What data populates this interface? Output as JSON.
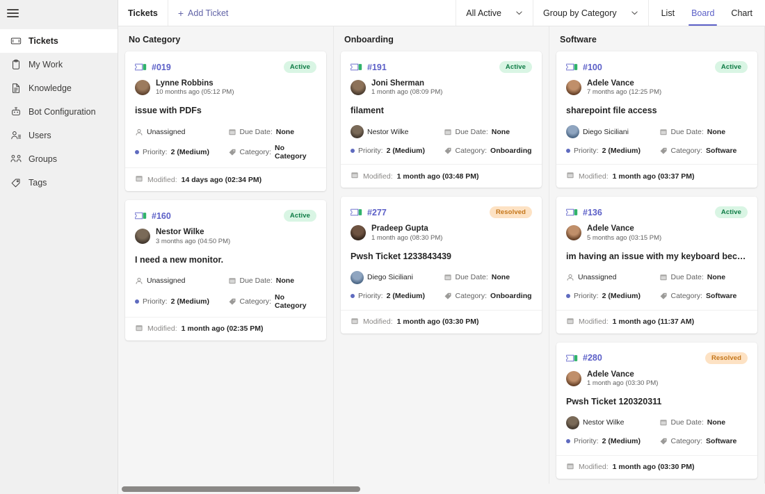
{
  "sidebar": {
    "menu_icon": "hamburger-icon",
    "items": [
      {
        "label": "Tickets",
        "icon": "ticket-icon",
        "active": true
      },
      {
        "label": "My Work",
        "icon": "clipboard-icon",
        "active": false
      },
      {
        "label": "Knowledge",
        "icon": "document-icon",
        "active": false
      },
      {
        "label": "Bot Configuration",
        "icon": "bot-icon",
        "active": false
      },
      {
        "label": "Users",
        "icon": "users-icon",
        "active": false
      },
      {
        "label": "Groups",
        "icon": "groups-icon",
        "active": false
      },
      {
        "label": "Tags",
        "icon": "tag-icon",
        "active": false
      }
    ]
  },
  "toolbar": {
    "title": "Tickets",
    "add_label": "Add Ticket",
    "add_icon": "plus-icon",
    "filter_label": "All Active",
    "group_label": "Group by Category",
    "chevron_icon": "chevron-down-icon",
    "views": [
      {
        "label": "List",
        "selected": false
      },
      {
        "label": "Board",
        "selected": true
      },
      {
        "label": "Chart",
        "selected": false
      }
    ]
  },
  "labels": {
    "due_date": "Due Date:",
    "category": "Category:",
    "priority": "Priority:",
    "modified": "Modified:",
    "unassigned": "Unassigned"
  },
  "colors": {
    "accent": "#5b5fc7",
    "active_badge_bg": "#d9f5e4",
    "active_badge_fg": "#0e7b45",
    "resolved_badge_bg": "#fde2c4",
    "resolved_badge_fg": "#c4761a",
    "sidebar_bg": "#f0f0f0",
    "board_bg": "#f5f5f5"
  },
  "board": {
    "columns": [
      {
        "title": "No Category",
        "cards": [
          {
            "id": "#019",
            "status": "Active",
            "status_kind": "active",
            "requester": "Lynne Robbins",
            "requester_time": "10 months ago (05:12 PM)",
            "avatar_colors": [
              "#9c7b5e",
              "#5a3f2b"
            ],
            "title": "issue with PDFs",
            "assignee": "Unassigned",
            "assignee_avatar": null,
            "assignee_colors": null,
            "priority": "2 (Medium)",
            "due_date": "None",
            "category": "No Category",
            "modified": "14 days ago (02:34 PM)"
          },
          {
            "id": "#160",
            "status": "Active",
            "status_kind": "active",
            "requester": "Nestor Wilke",
            "requester_time": "3 months ago (04:50 PM)",
            "avatar_colors": [
              "#7a6a58",
              "#3d332a"
            ],
            "title": "I need a new monitor.",
            "assignee": "Unassigned",
            "assignee_avatar": null,
            "assignee_colors": null,
            "priority": "2 (Medium)",
            "due_date": "None",
            "category": "No Category",
            "modified": "1 month ago (02:35 PM)"
          }
        ]
      },
      {
        "title": "Onboarding",
        "cards": [
          {
            "id": "#191",
            "status": "Active",
            "status_kind": "active",
            "requester": "Joni Sherman",
            "requester_time": "1 month ago (08:09 PM)",
            "avatar_colors": [
              "#8d7259",
              "#42352a"
            ],
            "title": "filament",
            "assignee": "Nestor Wilke",
            "assignee_avatar": "nestor",
            "assignee_colors": [
              "#7a6a58",
              "#3d332a"
            ],
            "priority": "2 (Medium)",
            "due_date": "None",
            "category": "Onboarding",
            "modified": "1 month ago (03:48 PM)"
          },
          {
            "id": "#277",
            "status": "Resolved",
            "status_kind": "resolved",
            "requester": "Pradeep Gupta",
            "requester_time": "1 month ago (08:30 PM)",
            "avatar_colors": [
              "#6e5341",
              "#2e2118"
            ],
            "title": "Pwsh Ticket 1233843439",
            "assignee": "Diego Siciliani",
            "assignee_avatar": "diego",
            "assignee_colors": [
              "#8fa5c0",
              "#44607f"
            ],
            "priority": "2 (Medium)",
            "due_date": "None",
            "category": "Onboarding",
            "modified": "1 month ago (03:30 PM)"
          }
        ]
      },
      {
        "title": "Software",
        "cards": [
          {
            "id": "#100",
            "status": "Active",
            "status_kind": "active",
            "requester": "Adele Vance",
            "requester_time": "7 months ago (12:25 PM)",
            "avatar_colors": [
              "#c08f6a",
              "#5e3a22"
            ],
            "title": "sharepoint file access",
            "assignee": "Diego Siciliani",
            "assignee_avatar": "diego",
            "assignee_colors": [
              "#8fa5c0",
              "#44607f"
            ],
            "priority": "2 (Medium)",
            "due_date": "None",
            "category": "Software",
            "modified": "1 month ago (03:37 PM)"
          },
          {
            "id": "#136",
            "status": "Active",
            "status_kind": "active",
            "requester": "Adele Vance",
            "requester_time": "5 months ago (03:15 PM)",
            "avatar_colors": [
              "#c08f6a",
              "#5e3a22"
            ],
            "title": "im having an issue with my keyboard because i…",
            "assignee": "Unassigned",
            "assignee_avatar": null,
            "assignee_colors": null,
            "priority": "2 (Medium)",
            "due_date": "None",
            "category": "Software",
            "modified": "1 month ago (11:37 AM)"
          },
          {
            "id": "#280",
            "status": "Resolved",
            "status_kind": "resolved",
            "requester": "Adele Vance",
            "requester_time": "1 month ago (03:30 PM)",
            "avatar_colors": [
              "#c08f6a",
              "#5e3a22"
            ],
            "title": "Pwsh Ticket 120320311",
            "assignee": "Nestor Wilke",
            "assignee_avatar": "nestor",
            "assignee_colors": [
              "#7a6a58",
              "#3d332a"
            ],
            "priority": "2 (Medium)",
            "due_date": "None",
            "category": "Software",
            "modified": "1 month ago (03:30 PM)"
          }
        ]
      }
    ]
  },
  "scrollbar": {
    "orientation": "horizontal",
    "thumb_fraction": 0.37
  }
}
